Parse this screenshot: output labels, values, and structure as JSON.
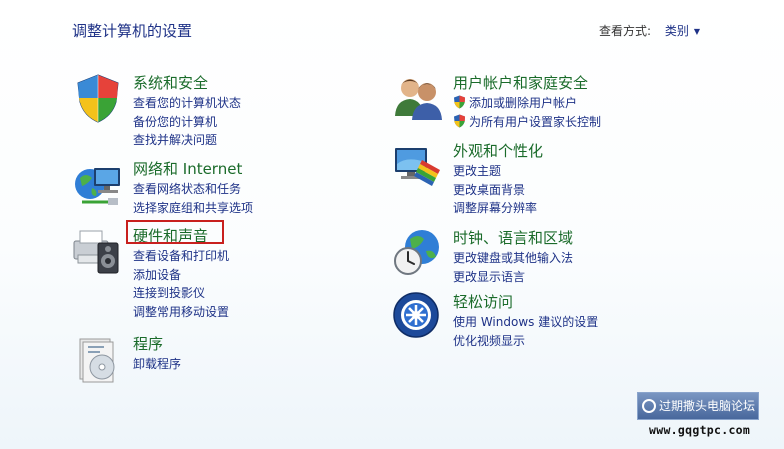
{
  "page": {
    "title": "调整计算机的设置"
  },
  "view_by": {
    "label": "查看方式:",
    "value": "类别"
  },
  "categories_left": [
    {
      "icon": "system-security-icon",
      "title": "系统和安全",
      "links": [
        "查看您的计算机状态",
        "备份您的计算机",
        "查找并解决问题"
      ]
    },
    {
      "icon": "network-internet-icon",
      "title": "网络和 Internet",
      "links": [
        "查看网络状态和任务",
        "选择家庭组和共享选项"
      ]
    },
    {
      "icon": "hardware-sound-icon",
      "title": "硬件和声音",
      "links": [
        "查看设备和打印机",
        "添加设备",
        "连接到投影仪",
        "调整常用移动设置"
      ]
    },
    {
      "icon": "programs-icon",
      "title": "程序",
      "links": [
        "卸载程序"
      ]
    }
  ],
  "categories_right": [
    {
      "icon": "user-accounts-icon",
      "title": "用户帐户和家庭安全",
      "links": [
        "添加或删除用户帐户",
        "为所有用户设置家长控制"
      ]
    },
    {
      "icon": "appearance-icon",
      "title": "外观和个性化",
      "links": [
        "更改主题",
        "更改桌面背景",
        "调整屏幕分辨率"
      ]
    },
    {
      "icon": "clock-language-region-icon",
      "title": "时钟、语言和区域",
      "links": [
        "更改键盘或其他输入法",
        "更改显示语言"
      ]
    },
    {
      "icon": "ease-of-access-icon",
      "title": "轻松访问",
      "links": [
        "使用 Windows 建议的设置",
        "优化视频显示"
      ]
    }
  ],
  "watermark": {
    "text": "过期撒头电脑论坛",
    "url": "www.gqgtpc.com"
  },
  "colors": {
    "heading": "#1a6b2a",
    "link": "#1e3287",
    "highlight": "#c8201e"
  }
}
